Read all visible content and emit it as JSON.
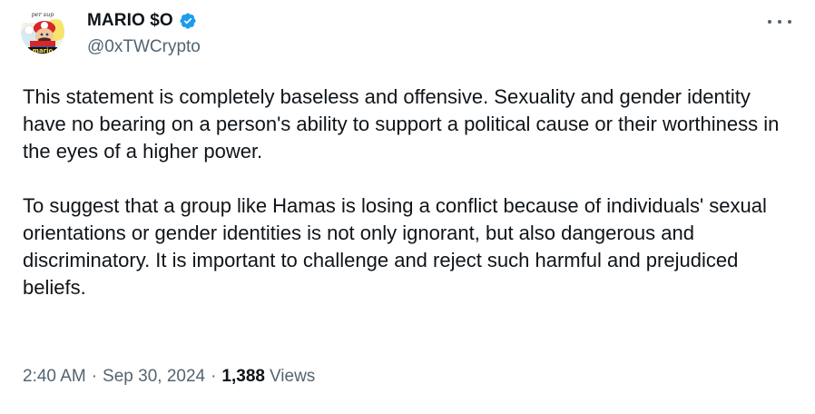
{
  "author": {
    "display_name": "MARIO $O",
    "handle": "@0xTWCrypto",
    "avatar_text_top": "per sup",
    "avatar_text_bottom": "mario"
  },
  "tweet": {
    "paragraphs": [
      "This statement is completely baseless and offensive. Sexuality and gender identity have no bearing on a person's ability to support a political cause or their worthiness in the eyes of a higher power.",
      "To suggest that a group like Hamas is losing a conflict because of individuals' sexual orientations or gender identities is not only ignorant, but also dangerous and discriminatory. It is important to challenge and reject such harmful and prejudiced beliefs."
    ],
    "time": "2:40 AM",
    "date": "Sep 30, 2024",
    "separator": "·",
    "views_count": "1,388",
    "views_label": "Views"
  },
  "colors": {
    "text_primary": "#0f1419",
    "text_secondary": "#536471",
    "verified_blue": "#1d9bf0"
  },
  "icons": {
    "verified": "verified-badge-icon",
    "more": "more-horizontal-icon"
  }
}
